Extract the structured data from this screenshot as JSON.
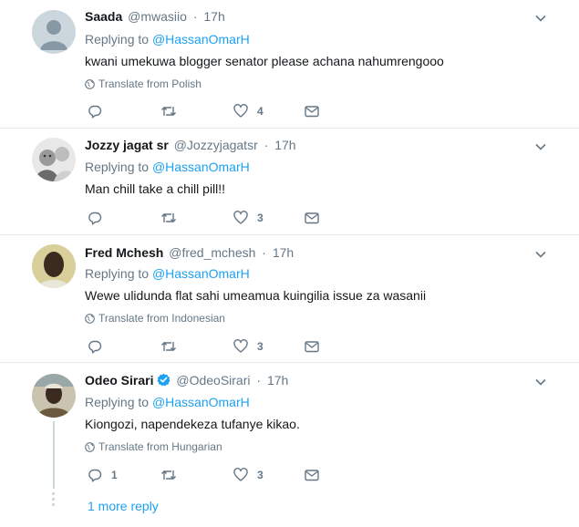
{
  "tweets": [
    {
      "name": "Saada",
      "handle": "@mwasiio",
      "time": "17h",
      "replying_prefix": "Replying to",
      "replying_to": "@HassanOmarH",
      "text": "kwani umekuwa blogger senator please achana nahumrengooo",
      "translate": "Translate from Polish",
      "reply_count": "",
      "retweet_count": "",
      "like_count": "4"
    },
    {
      "name": "Jozzy jagat sr",
      "handle": "@Jozzyjagatsr",
      "time": "17h",
      "replying_prefix": "Replying to",
      "replying_to": "@HassanOmarH",
      "text": "Man chill take a chill pill!!",
      "translate": "",
      "reply_count": "",
      "retweet_count": "",
      "like_count": "3"
    },
    {
      "name": "Fred Mchesh",
      "handle": "@fred_mchesh",
      "time": "17h",
      "replying_prefix": "Replying to",
      "replying_to": "@HassanOmarH",
      "text": "Wewe ulidunda flat sahi umeamua kuingilia issue za wasanii",
      "translate": "Translate from Indonesian",
      "reply_count": "",
      "retweet_count": "",
      "like_count": "3"
    },
    {
      "name": "Odeo Sirari",
      "handle": "@OdeoSirari",
      "time": "17h",
      "replying_prefix": "Replying to",
      "replying_to": "@HassanOmarH",
      "text": "Kiongozi, napendekeza tufanye kikao.",
      "translate": "Translate from Hungarian",
      "reply_count": "1",
      "retweet_count": "",
      "like_count": "3"
    }
  ],
  "more_reply": "1 more reply",
  "colors": {
    "accent": "#1da1f2",
    "secondary_text": "#657786",
    "divider": "#e6ecf0"
  }
}
